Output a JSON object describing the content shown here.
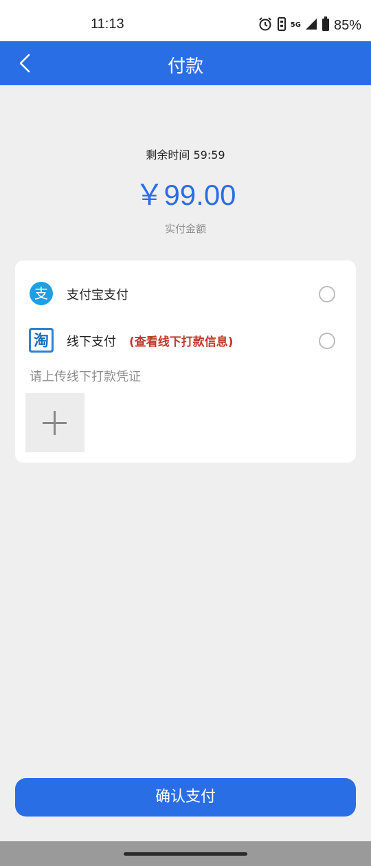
{
  "status_bar": {
    "time": "11:13",
    "network": "5G",
    "battery": "85%"
  },
  "nav": {
    "title": "付款"
  },
  "payment": {
    "timer": "剩余时间 59:59",
    "amount": "￥99.00",
    "amount_label": "实付金额"
  },
  "options": [
    {
      "label": "支付宝支付",
      "icon": "alipay-icon"
    },
    {
      "label": "线下支付",
      "link": "(查看线下打款信息)",
      "icon": "taobao-icon"
    }
  ],
  "upload": {
    "hint": "请上传线下打款凭证"
  },
  "confirm": {
    "label": "确认支付"
  },
  "colors": {
    "primary": "#2a6ee6",
    "link": "#c0392b",
    "alipay": "#1ca0e3"
  }
}
